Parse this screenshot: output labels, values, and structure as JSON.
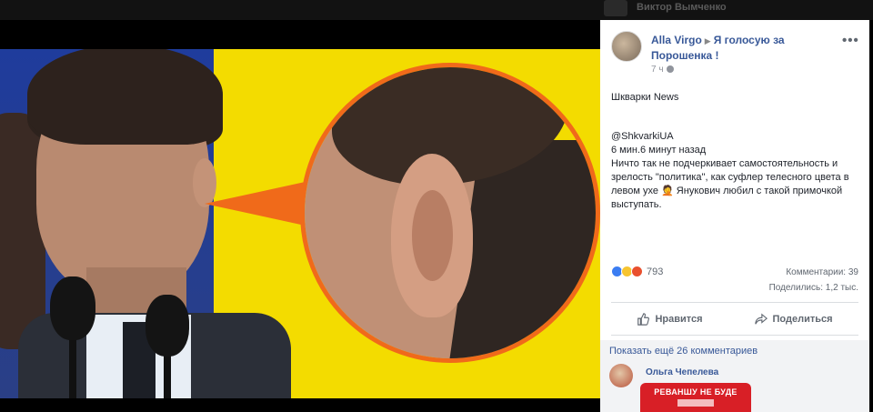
{
  "background": {
    "name": "Виктор Вымченко"
  },
  "post": {
    "author": "Alla Virgo",
    "target": "Я голосую за Порошенка !",
    "time": "7 ч",
    "more": "•••",
    "source_name": "Шкварки News",
    "handle": "@ShkvarkiUA",
    "posted_ago": "6 мин.6 минут назад",
    "text": "Ничто так не подчеркивает самостоятельность и зрелость \"политика\", как суфлер телесного цвета в левом ухе 🤦 Янукович любил с такой примочкой выступать.",
    "reactions_count": "793",
    "comments_count": "Комментарии: 39",
    "shares_count": "Поделились: 1,2 тыс.",
    "like_label": "Нравится",
    "share_label": "Поделиться"
  },
  "comments": {
    "show_more": "Показать ещё 26 комментариев",
    "first_name": "Ольга Чепелева",
    "sticker_text": "РЕВАНШУ НЕ БУДЕ"
  },
  "colors": {
    "link": "#385898",
    "accent_orange": "#f06a1a",
    "flag_yellow": "#f3dc00",
    "flag_blue": "#2a3f86"
  }
}
